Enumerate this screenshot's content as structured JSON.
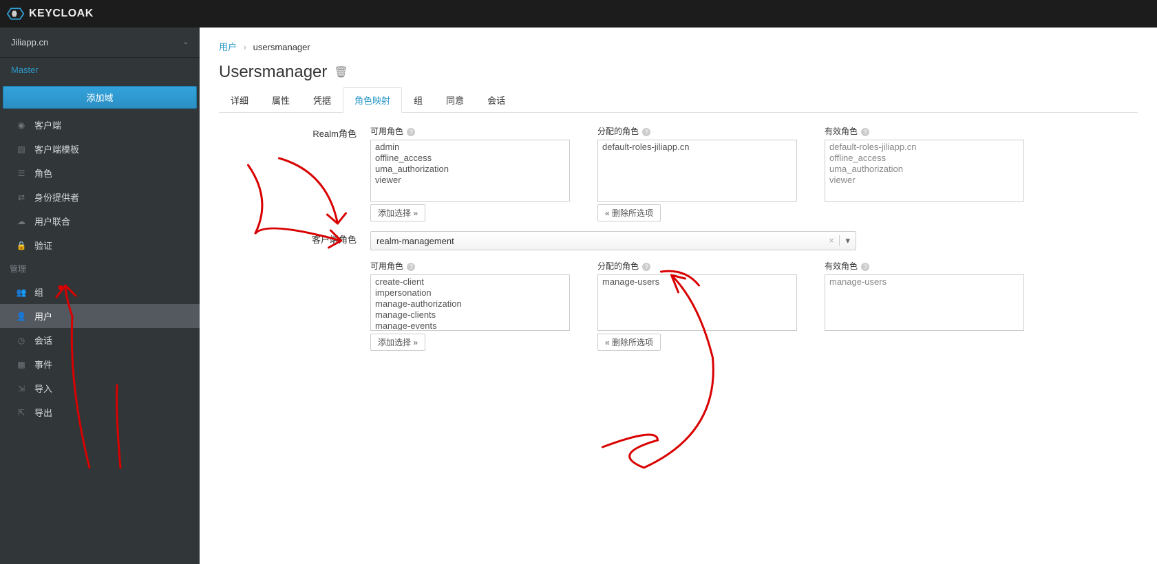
{
  "header": {
    "brand": "KEYCLOAK"
  },
  "sidebar": {
    "realm": "Jiliapp.cn",
    "master_link": "Master",
    "add_realm_btn": "添加域",
    "section_label": "管理",
    "items_top": [
      {
        "icon": "globe",
        "label": "客户端"
      },
      {
        "icon": "layers",
        "label": "客户端模板"
      },
      {
        "icon": "list",
        "label": "角色"
      },
      {
        "icon": "exchange",
        "label": "身份提供者"
      },
      {
        "icon": "cloud",
        "label": "用户联合"
      },
      {
        "icon": "lock",
        "label": "验证"
      }
    ],
    "items_manage": [
      {
        "icon": "group",
        "label": "组"
      },
      {
        "icon": "user",
        "label": "用户",
        "active": true
      },
      {
        "icon": "clock",
        "label": "会话"
      },
      {
        "icon": "calendar",
        "label": "事件"
      },
      {
        "icon": "import",
        "label": "导入"
      },
      {
        "icon": "export",
        "label": "导出"
      }
    ]
  },
  "breadcrumb": {
    "root": "用户",
    "current": "usersmanager"
  },
  "page": {
    "title": "Usersmanager"
  },
  "tabs": [
    {
      "label": "详细"
    },
    {
      "label": "属性"
    },
    {
      "label": "凭据"
    },
    {
      "label": "角色映射",
      "active": true
    },
    {
      "label": "组"
    },
    {
      "label": "同意"
    },
    {
      "label": "会话"
    }
  ],
  "roleMapping": {
    "realm_label": "Realm角色",
    "client_label": "客户端角色",
    "available_label": "可用角色",
    "assigned_label": "分配的角色",
    "effective_label": "有效角色",
    "add_selected_btn": "添加选择 »",
    "remove_selected_btn": "« 删除所选项",
    "realm_available": [
      "admin",
      "offline_access",
      "uma_authorization",
      "viewer"
    ],
    "realm_assigned": [
      "default-roles-jiliapp.cn"
    ],
    "realm_effective": [
      "default-roles-jiliapp.cn",
      "offline_access",
      "uma_authorization",
      "viewer"
    ],
    "client_selected": "realm-management",
    "client_available": [
      "create-client",
      "impersonation",
      "manage-authorization",
      "manage-clients",
      "manage-events"
    ],
    "client_assigned": [
      "manage-users"
    ],
    "client_effective": [
      "manage-users"
    ]
  }
}
